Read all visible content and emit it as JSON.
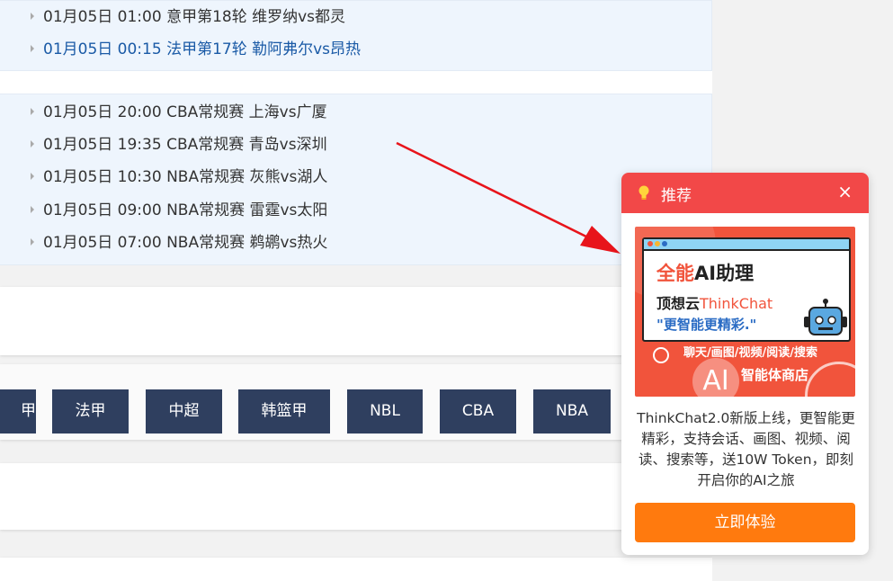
{
  "matches_top": [
    {
      "time": "01月05日 01:00",
      "league": "意甲第18轮",
      "teams": "维罗纳vs都灵"
    },
    {
      "time": "01月05日 00:15",
      "league": "法甲第17轮",
      "teams": "勒阿弗尔vs昂热"
    }
  ],
  "matches_basketball": [
    {
      "time": "01月05日 20:00",
      "league": "CBA常规赛",
      "teams": "上海vs广厦"
    },
    {
      "time": "01月05日 19:35",
      "league": "CBA常规赛",
      "teams": "青岛vs深圳"
    },
    {
      "time": "01月05日 10:30",
      "league": "NBA常规赛",
      "teams": "灰熊vs湖人"
    },
    {
      "time": "01月05日 09:00",
      "league": "NBA常规赛",
      "teams": "雷霆vs太阳"
    },
    {
      "time": "01月05日 07:00",
      "league": "NBA常规赛",
      "teams": "鹈鹕vs热火"
    }
  ],
  "league_tabs": [
    "甲",
    "法甲",
    "中超",
    "韩篮甲",
    "NBL",
    "CBA",
    "NBA"
  ],
  "popup": {
    "icon": "lightbulb-icon",
    "title": "推荐",
    "close": "×",
    "banner": {
      "headline_prefix": "全能",
      "headline_ai": "AI",
      "headline_suffix": "助理",
      "brand_prefix": "顶想云",
      "brand_name": "ThinkChat",
      "slogan": "\"更智能更精彩.\"",
      "features": "聊天/画图/视频/阅读/搜索",
      "ai_badge": "AI",
      "store": "智能体商店"
    },
    "description": "ThinkChat2.0新版上线，更智能更精彩，支持会话、画图、视频、阅读、搜索等，送10W Token，即刻开启你的AI之旅",
    "cta": "立即体验"
  },
  "colors": {
    "tab_bg": "#2f3f5f",
    "popup_header": "#f24848",
    "cta": "#ff7a0e",
    "active_link": "#1a5aa6",
    "arrow": "#e8141b"
  }
}
